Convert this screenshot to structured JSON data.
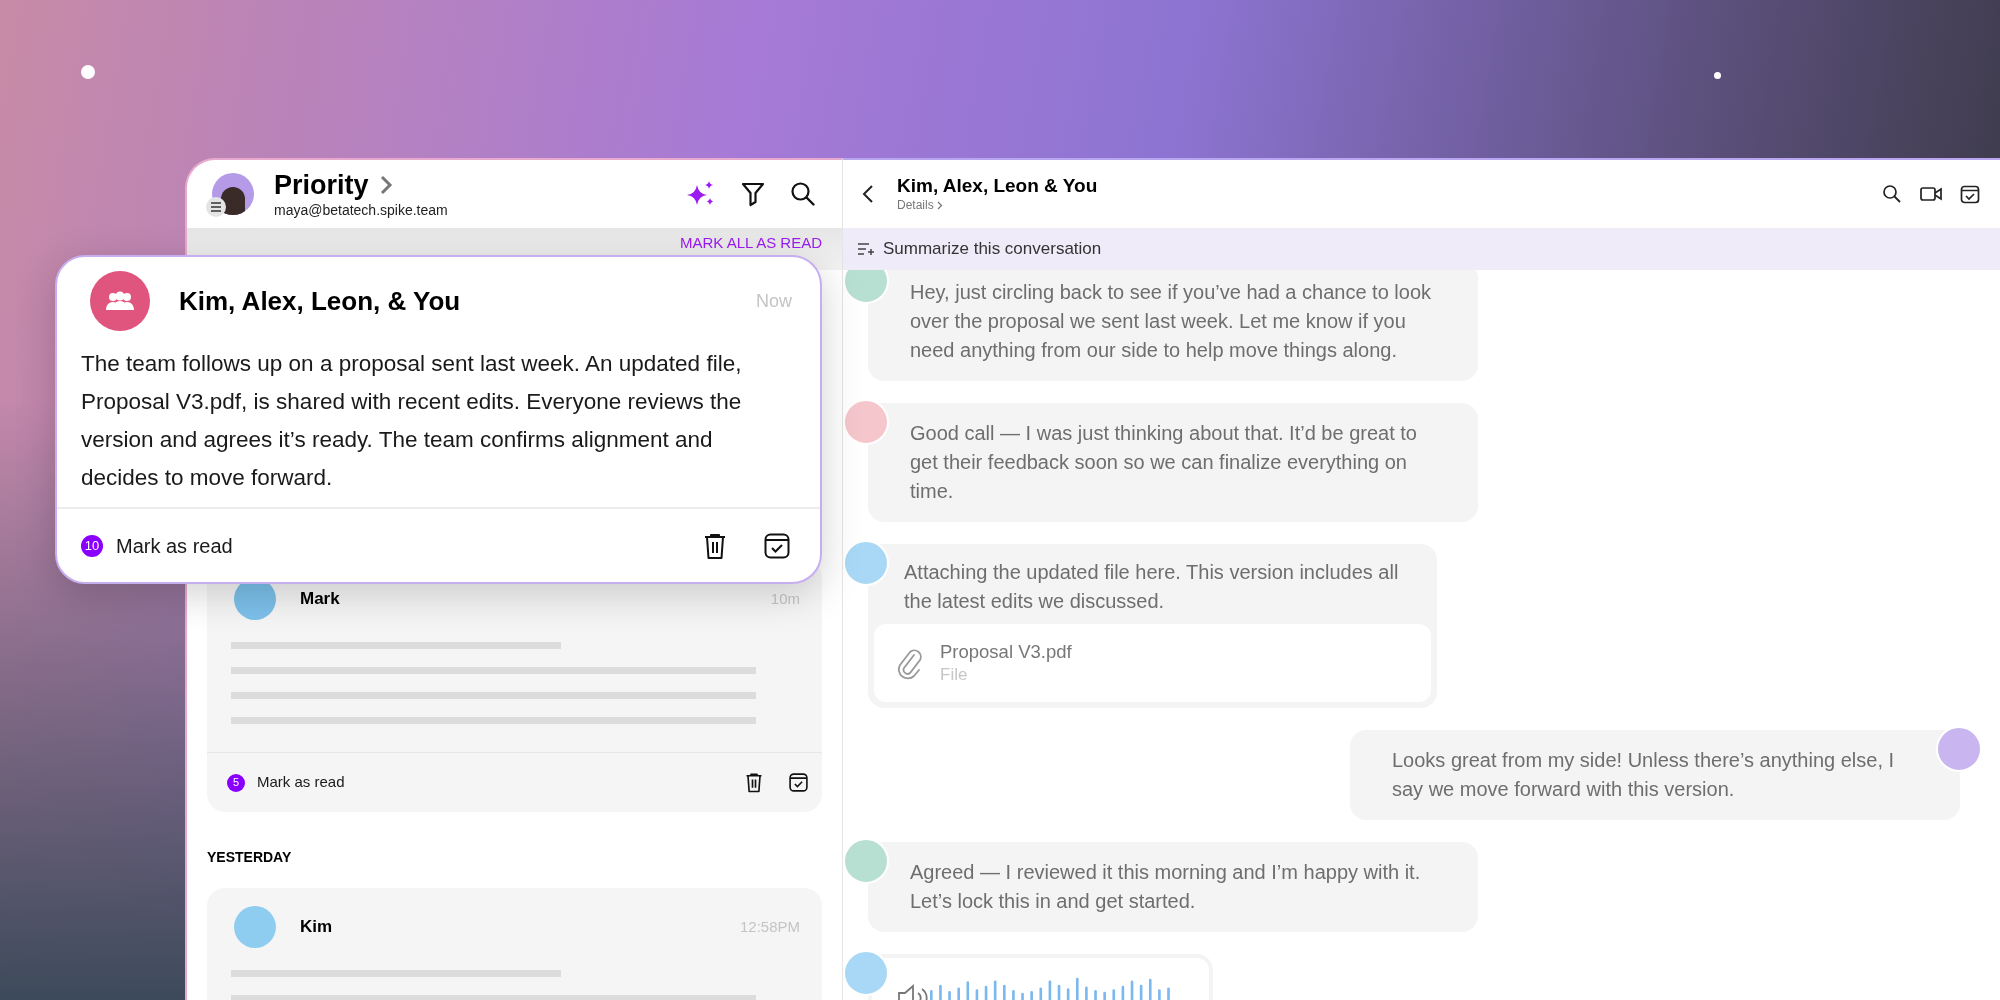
{
  "inbox": {
    "title": "Priority",
    "account": "maya@betatech.spike.team",
    "mark_all_read": "MARK ALL AS READ",
    "sections": [
      {
        "items": [
          {
            "name": "Mark",
            "time": "10m",
            "badge": "5",
            "action": "Mark as read",
            "color": "#7cc0ea"
          }
        ]
      },
      {
        "heading": "YESTERDAY",
        "items": [
          {
            "name": "Kim",
            "time": "12:58PM",
            "color": "#8fcdf0"
          }
        ]
      }
    ]
  },
  "popup": {
    "title": "Kim, Alex, Leon, & You",
    "time": "Now",
    "summary": "The team follows up on a proposal sent last week. An updated file, Proposal V3.pdf, is shared with recent edits. Everyone reviews the version and agrees it’s ready. The team confirms alignment and decides to move forward.",
    "badge": "10",
    "action": "Mark as read"
  },
  "conversation": {
    "title": "Kim, Alex, Leon & You",
    "details": "Details",
    "summarize": "Summarize this conversation",
    "messages": [
      {
        "kind": "text",
        "outgoing": false,
        "color": "#b8e0d2",
        "text": "Hey, just circling back to see if you’ve had a chance to look over the proposal we sent last week. Let me know if you need anything from our side to help move things along."
      },
      {
        "kind": "text",
        "outgoing": false,
        "color": "#f5c6cc",
        "text": "Good call — I was just thinking about that. It’d be great to get their feedback soon so we can finalize everything on time."
      },
      {
        "kind": "file",
        "outgoing": false,
        "color": "#a8d8f5",
        "text": "Attaching the updated file here. This version includes all the latest edits we discussed.",
        "file_name": "Proposal V3.pdf",
        "file_type": "File"
      },
      {
        "kind": "text",
        "outgoing": true,
        "color": "#c9b6f0",
        "text": "Looks great from my side! Unless there’s anything else, I say we move forward with this version."
      },
      {
        "kind": "text",
        "outgoing": false,
        "color": "#b8e0d2",
        "text": "Agreed — I reviewed it this morning and I’m happy with it. Let’s lock this in and get started."
      },
      {
        "kind": "voice",
        "outgoing": false,
        "color": "#a8d8f5"
      }
    ]
  }
}
